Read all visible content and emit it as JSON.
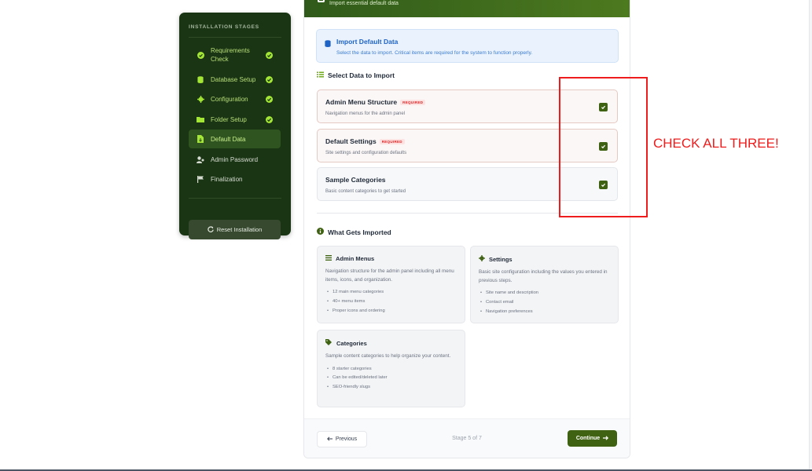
{
  "sidebar": {
    "title": "INSTALLATION STAGES",
    "items": [
      {
        "label": "Requirements Check",
        "icon": "check-circle-icon",
        "done": true
      },
      {
        "label": "Database Setup",
        "icon": "database-icon",
        "done": true
      },
      {
        "label": "Configuration",
        "icon": "gear-icon",
        "done": true
      },
      {
        "label": "Folder Setup",
        "icon": "folder-icon",
        "done": true
      },
      {
        "label": "Default Data",
        "icon": "file-import-icon",
        "active": true
      },
      {
        "label": "Admin Password",
        "icon": "user-key-icon"
      },
      {
        "label": "Finalization",
        "icon": "flag-icon"
      }
    ],
    "reset_label": "Reset Installation"
  },
  "header": {
    "subtitle": "Import essential default data"
  },
  "info": {
    "title": "Import Default Data",
    "description": "Select the data to import. Critical items are required for the system to function properly."
  },
  "select_section": {
    "title": "Select Data to Import",
    "options": [
      {
        "name": "Admin Menu Structure",
        "badge": "REQUIRED",
        "description": "Navigation menus for the admin panel",
        "checked": true
      },
      {
        "name": "Default Settings",
        "badge": "REQUIRED",
        "description": "Site settings and configuration defaults",
        "checked": true
      },
      {
        "name": "Sample Categories",
        "badge": "",
        "description": "Basic content categories to get started",
        "checked": true
      }
    ]
  },
  "imported_section": {
    "title": "What Gets Imported",
    "tiles": [
      {
        "title": "Admin Menus",
        "icon": "list-icon",
        "text": "Navigation structure for the admin panel including all menu items, icons, and organization.",
        "bullets": [
          "12 main menu categories",
          "40+ menu items",
          "Proper icons and ordering"
        ]
      },
      {
        "title": "Settings",
        "icon": "gear-icon",
        "text": "Basic site configuration including the values you entered in previous steps.",
        "bullets": [
          "Site name and description",
          "Contact email",
          "Navigation preferences"
        ]
      },
      {
        "title": "Categories",
        "icon": "tag-icon",
        "text": "Sample content categories to help organize your content.",
        "bullets": [
          "8 starter categories",
          "Can be edited/deleted later",
          "SEO-friendly slugs"
        ]
      }
    ]
  },
  "footer": {
    "previous_label": "Previous",
    "stage_text": "Stage 5 of 7",
    "continue_label": "Continue"
  },
  "annotation": {
    "text": "CHECK ALL THREE!",
    "color": "#ee1c1c"
  },
  "colors": {
    "sidebar_bg": "#1a3513",
    "accent_green": "#3f6212",
    "lime": "#a3e635",
    "info_blue": "#1f63c4",
    "required_red": "#e02424"
  }
}
